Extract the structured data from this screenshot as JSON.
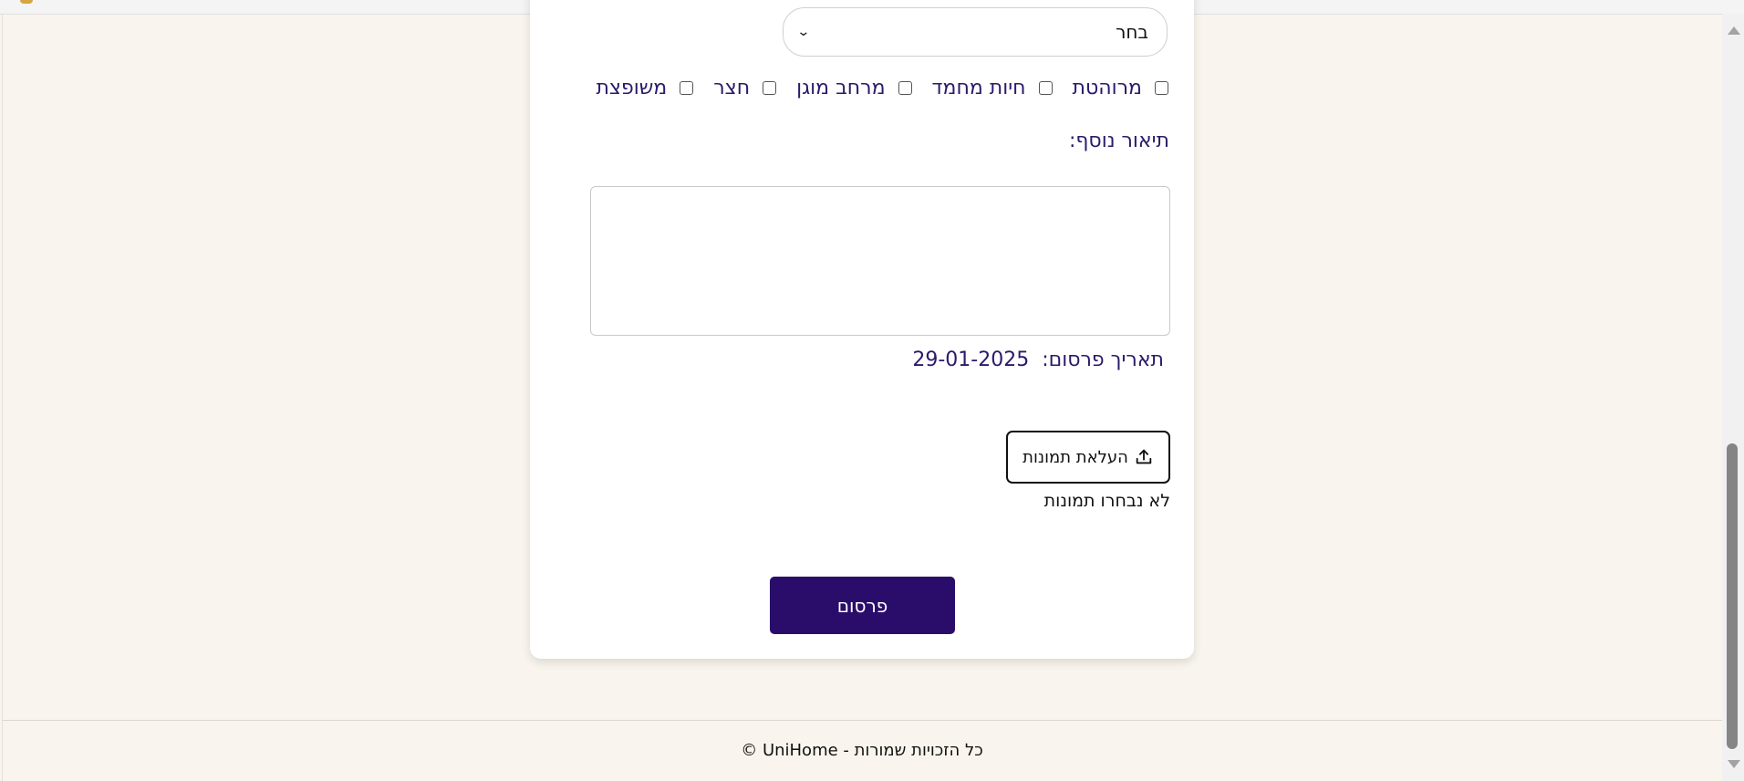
{
  "form": {
    "select": {
      "value": "בחר"
    },
    "amenities": [
      {
        "label": "מרוהטת",
        "checked": false
      },
      {
        "label": "חיות מחמד",
        "checked": false
      },
      {
        "label": "מרחב מוגן",
        "checked": false
      },
      {
        "label": "חצר",
        "checked": false
      },
      {
        "label": "משופצת",
        "checked": false
      }
    ],
    "description_label": "תיאור נוסף:",
    "description_value": "",
    "date_label": "תאריך פרסום:",
    "date_value": "29-01-2025",
    "upload_label": "העלאת תמונות",
    "no_images_text": "לא נבחרו תמונות",
    "publish_label": "פרסום"
  },
  "footer": {
    "text": "© UniHome - כל הזכויות שמורות"
  },
  "icons": {
    "select_chevron": "chevron-down-icon",
    "upload": "upload-icon"
  },
  "colors": {
    "accent": "#2a0d6b",
    "label_text": "#2b1a6b",
    "page_bg": "#f9f5ee"
  }
}
